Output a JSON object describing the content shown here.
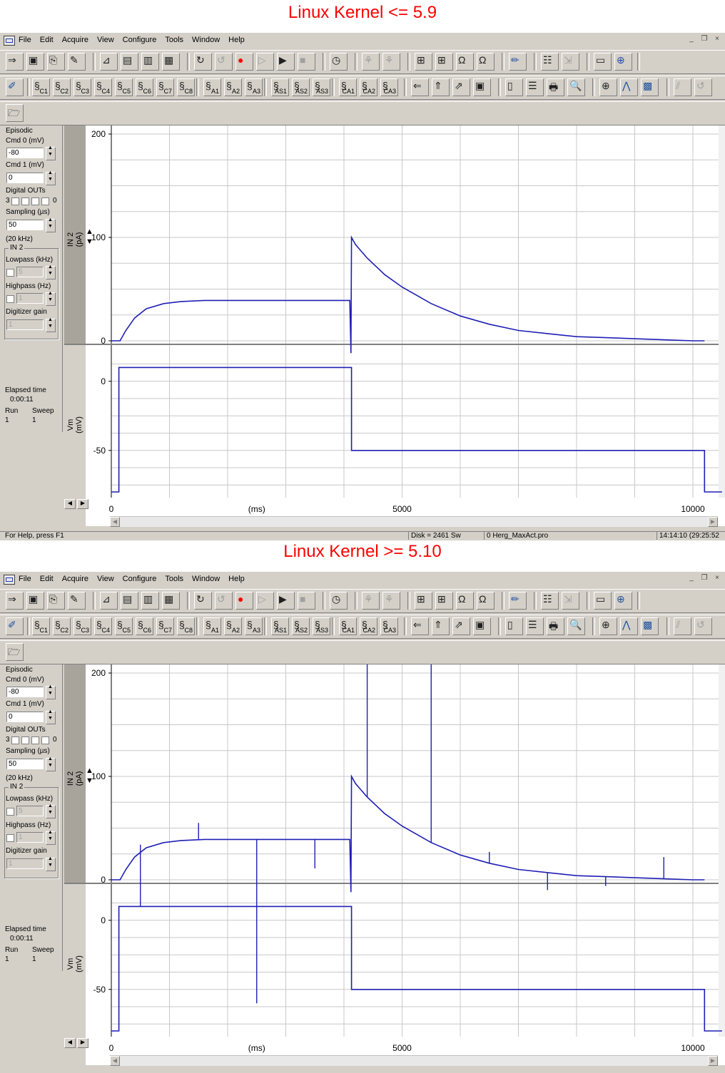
{
  "captions": [
    "Linux Kernel <= 5.9",
    "Linux Kernel >= 5.10"
  ],
  "menu": [
    "File",
    "Edit",
    "Acquire",
    "View",
    "Configure",
    "Tools",
    "Window",
    "Help"
  ],
  "window_controls": [
    "_",
    "❐",
    "×"
  ],
  "toolbar2_labels": [
    "C1",
    "C2",
    "C3",
    "C4",
    "C5",
    "C6",
    "C7",
    "C8",
    "A1",
    "A2",
    "A3",
    "AS1",
    "AS2",
    "AS3",
    "CA1",
    "CA2",
    "CA3"
  ],
  "toolbar1_icons": [
    "open-icon",
    "save-icon",
    "save-as-icon",
    "edit-icon",
    "analyze-icon",
    "table-icon",
    "chart-icon",
    "grid-icon",
    "loop-icon",
    "continue-icon",
    "record-icon",
    "step-icon",
    "play-icon",
    "stop-icon",
    "timer-icon",
    "compare-icon",
    "compare2-icon",
    "seal-icon",
    "seal2-icon",
    "ohm0-icon",
    "ohm1-icon",
    "pen-icon",
    "clipboard-icon",
    "export-icon",
    "display-icon",
    "network-icon"
  ],
  "panel": {
    "mode": "Episodic",
    "cmd0_label": "Cmd 0 (mV)",
    "cmd0_value": "-80",
    "cmd1_label": "Cmd 1 (mV)",
    "cmd1_value": "0",
    "digital_label": "Digital OUTs",
    "digital_hi": "3",
    "digital_lo": "0",
    "sampling_label": "Sampling (µs)",
    "sampling_value": "50",
    "sampling_rate": "(20 kHz)",
    "group_label": "IN 2",
    "lowpass_label": "Lowpass (kHz)",
    "lowpass_value": "5",
    "highpass_label": "Highpass (Hz)",
    "highpass_value": "1",
    "gain_label": "Digitizer gain",
    "gain_value": "1",
    "elapsed_label": "Elapsed time",
    "elapsed_value": "0:00:11",
    "run_label": "Run",
    "sweep_label": "Sweep",
    "run_value": "1",
    "sweep_value": "1"
  },
  "panel2": {
    "cmd0_label": "Cmd 0 (mV)"
  },
  "axes": {
    "top_ylabel_line1": "IN 2",
    "top_ylabel_line2": "(pA)",
    "top_ticks": [
      "200",
      "100",
      "0"
    ],
    "bottom_ylabel_line1": "Vm",
    "bottom_ylabel_line2": "(mV)",
    "bottom_ticks": [
      "0",
      "-50"
    ],
    "x_ticks": [
      "0",
      "5000",
      "10000"
    ],
    "x_label": "(ms)"
  },
  "status1": {
    "help": "For Help, press F1",
    "disk": "Disk = 2461 Sw",
    "protocol": "0  Herg_MaxAct.pro",
    "time": "14:14:10 (29:25:52"
  },
  "colors": {
    "trace": "#1f1fb5",
    "grid": "#c8c8c8",
    "caption": "#ff0000",
    "chrome": "#d4d0c8"
  },
  "chart_data": [
    {
      "type": "line",
      "title": "Linux Kernel <= 5.9",
      "x_unit": "ms",
      "xlim": [
        0,
        10500
      ],
      "panels": [
        {
          "ylabel": "IN 2 (pA)",
          "ylim": [
            0,
            200
          ],
          "series": [
            {
              "x": [
                0,
                150,
                250,
                400,
                600,
                900,
                1200,
                1600,
                2000,
                2500,
                3000,
                3500,
                4100,
                4120,
                4130,
                4200,
                4400,
                4700,
                5000,
                5500,
                6000,
                6500,
                7000,
                7500,
                8000,
                8500,
                9000,
                9500,
                10000,
                10200
              ],
              "y": [
                0,
                0,
                10,
                22,
                31,
                36,
                38,
                39,
                39,
                39,
                39,
                39,
                39,
                -12,
                100,
                93,
                80,
                64,
                52,
                36,
                24,
                16,
                10,
                7,
                4,
                3,
                2,
                1,
                0,
                0
              ]
            }
          ]
        },
        {
          "ylabel": "Vm (mV)",
          "ylim": [
            -80,
            20
          ],
          "series": [
            {
              "x": [
                0,
                130,
                130,
                4130,
                4130,
                10200,
                10200,
                10500
              ],
              "y": [
                -80,
                -80,
                10,
                10,
                -50,
                -50,
                -80,
                -80
              ]
            }
          ]
        }
      ]
    },
    {
      "type": "line",
      "title": "Linux Kernel >= 5.10",
      "x_unit": "ms",
      "xlim": [
        0,
        10500
      ],
      "panels": [
        {
          "ylabel": "IN 2 (pA)",
          "ylim": [
            0,
            200
          ],
          "series": [
            {
              "x": [
                0,
                150,
                250,
                400,
                600,
                900,
                1200,
                1600,
                2000,
                2500,
                3000,
                3500,
                4100,
                4120,
                4130,
                4200,
                4400,
                4700,
                5000,
                5500,
                6000,
                6500,
                7000,
                7500,
                8000,
                8500,
                9000,
                9500,
                10000,
                10200
              ],
              "y": [
                0,
                0,
                10,
                22,
                31,
                36,
                38,
                39,
                39,
                39,
                39,
                39,
                39,
                -12,
                100,
                93,
                80,
                64,
                52,
                36,
                24,
                16,
                10,
                7,
                4,
                3,
                2,
                1,
                0,
                0
              ]
            }
          ],
          "spikes": [
            {
              "x": 500,
              "y_from": 34,
              "y_to": -32
            },
            {
              "x": 1500,
              "y_from": 39,
              "y_to": 55
            },
            {
              "x": 2500,
              "y_from": 39,
              "y_to": -60
            },
            {
              "x": 3500,
              "y_from": 39,
              "y_to": 11
            },
            {
              "x": 4400,
              "y_from": 80,
              "y_to": 200
            },
            {
              "x": 5500,
              "y_from": 36,
              "y_to": 200
            },
            {
              "x": 6500,
              "y_from": 16,
              "y_to": 27
            },
            {
              "x": 7500,
              "y_from": 7,
              "y_to": -10
            },
            {
              "x": 8500,
              "y_from": 3,
              "y_to": -6
            },
            {
              "x": 9500,
              "y_from": 1,
              "y_to": 22
            }
          ]
        },
        {
          "ylabel": "Vm (mV)",
          "ylim": [
            -80,
            20
          ],
          "series": [
            {
              "x": [
                0,
                130,
                130,
                4130,
                4130,
                10200,
                10200,
                10500
              ],
              "y": [
                -80,
                -80,
                10,
                10,
                -50,
                -50,
                -80,
                -80
              ]
            }
          ],
          "spikes": [
            {
              "x": 2500,
              "y_from": 10,
              "y_to": -60
            }
          ]
        }
      ]
    }
  ]
}
